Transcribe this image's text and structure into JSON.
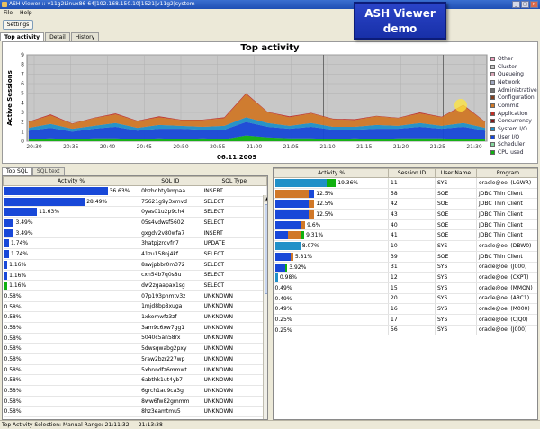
{
  "window": {
    "title": "ASH Viewer :: v11g2Linux86-64|192.168.150.10|1521|v11g2|system"
  },
  "menu": [
    "File",
    "Help"
  ],
  "toolbar": {
    "settings_label": "Settings"
  },
  "tabs": [
    "Top activity",
    "Detail",
    "History"
  ],
  "overlay": {
    "line1": "ASH Viewer",
    "line2": "demo"
  },
  "chart": {
    "title": "Top activity",
    "ylabel": "Active Sessions",
    "date": "06.11.2009",
    "colors": {
      "Other": "#f0a0c0",
      "Cluster": "#c8c8c8",
      "Queueing": "#d8a8b8",
      "Network": "#a0a8c0",
      "Administrative": "#707070",
      "Configuration": "#804020",
      "Commit": "#d07828",
      "Application": "#c03028",
      "Concurrency": "#801818",
      "System I/O": "#2090c8",
      "User I/O": "#1848d8",
      "Scheduler": "#88d8a0",
      "CPU used": "#10b010"
    }
  },
  "chart_data": {
    "type": "area",
    "title": "Top activity",
    "xlabel": "",
    "ylabel": "Active Sessions",
    "ylim": [
      0,
      9
    ],
    "x_ticks": [
      "20:30",
      "20:35",
      "20:40",
      "20:45",
      "20:50",
      "20:55",
      "21:00",
      "21:05",
      "21:10",
      "21:15",
      "21:20",
      "21:25",
      "21:30"
    ],
    "y_ticks": [
      "0",
      "1",
      "2",
      "3",
      "4",
      "5",
      "6",
      "7",
      "8",
      "9"
    ],
    "legend": [
      "Other",
      "Cluster",
      "Queueing",
      "Network",
      "Administrative",
      "Configuration",
      "Commit",
      "Application",
      "Concurrency",
      "System I/O",
      "User I/O",
      "Scheduler",
      "CPU used"
    ],
    "legend_position": "right",
    "grid": true,
    "x": [
      "20:30",
      "20:33",
      "20:36",
      "20:39",
      "20:42",
      "20:45",
      "20:48",
      "20:51",
      "20:54",
      "20:57",
      "21:00",
      "21:03",
      "21:06",
      "21:09",
      "21:12",
      "21:15",
      "21:18",
      "21:21",
      "21:24",
      "21:27",
      "21:30",
      "21:33"
    ],
    "series": [
      {
        "name": "CPU used",
        "values": [
          0.2,
          0.3,
          0.2,
          0.3,
          0.3,
          0.2,
          0.3,
          0.2,
          0.3,
          0.2,
          0.6,
          0.4,
          0.3,
          0.3,
          0.2,
          0.3,
          0.2,
          0.3,
          0.3,
          0.3,
          0.2,
          0.2
        ]
      },
      {
        "name": "User I/O",
        "values": [
          0.9,
          1.1,
          0.8,
          1.0,
          1.2,
          0.9,
          1.0,
          1.1,
          0.9,
          1.0,
          1.4,
          1.1,
          1.0,
          1.2,
          1.0,
          0.9,
          1.1,
          1.0,
          1.2,
          1.0,
          1.3,
          0.9
        ]
      },
      {
        "name": "System I/O",
        "values": [
          0.3,
          0.4,
          0.3,
          0.3,
          0.4,
          0.3,
          0.4,
          0.3,
          0.3,
          0.4,
          0.5,
          0.4,
          0.3,
          0.4,
          0.3,
          0.3,
          0.4,
          0.3,
          0.4,
          0.3,
          0.4,
          0.3
        ]
      },
      {
        "name": "Commit",
        "values": [
          0.6,
          0.9,
          0.5,
          0.8,
          0.9,
          0.7,
          0.8,
          0.6,
          0.7,
          0.8,
          2.4,
          1.1,
          0.9,
          1.0,
          0.8,
          0.7,
          0.9,
          0.8,
          1.0,
          0.9,
          1.8,
          0.6
        ]
      },
      {
        "name": "Application",
        "values": [
          0.05,
          0.1,
          0.05,
          0.05,
          0.1,
          0.05,
          0.1,
          0.05,
          0.05,
          0.1,
          0.1,
          0.05,
          0.1,
          0.05,
          0.05,
          0.1,
          0.05,
          0.05,
          0.1,
          0.05,
          0.1,
          0.05
        ]
      }
    ]
  },
  "selection": {
    "start": "21:11:32",
    "end": "21:13:38"
  },
  "subtabs": [
    "Top SQL",
    "SQL text"
  ],
  "sql_table": {
    "headers": [
      "Activity %",
      "SQL ID",
      "SQL Type"
    ],
    "rows": [
      {
        "pct": "36.63%",
        "value": 36.63,
        "sql_id": "0bzhqhty9mpaa",
        "type": "INSERT",
        "seg": [
          "#1848d8"
        ]
      },
      {
        "pct": "28.49%",
        "value": 28.49,
        "sql_id": "75621g9y3xmvd",
        "type": "SELECT",
        "seg": [
          "#1848d8"
        ]
      },
      {
        "pct": "11.63%",
        "value": 11.63,
        "sql_id": "0yas01u2p9ch4",
        "type": "SELECT",
        "seg": [
          "#1848d8"
        ]
      },
      {
        "pct": "3.49%",
        "value": 3.49,
        "sql_id": "05s4vdwsf5602",
        "type": "SELECT",
        "seg": [
          "#1848d8"
        ]
      },
      {
        "pct": "3.49%",
        "value": 3.49,
        "sql_id": "gxgdv2v80wfa7",
        "type": "INSERT",
        "seg": [
          "#1848d8"
        ]
      },
      {
        "pct": "1.74%",
        "value": 1.74,
        "sql_id": "3hatpjzrqvfn7",
        "type": "UPDATE",
        "seg": [
          "#1848d8"
        ]
      },
      {
        "pct": "1.74%",
        "value": 1.74,
        "sql_id": "41zu158nj4kf",
        "type": "SELECT",
        "seg": [
          "#1848d8"
        ]
      },
      {
        "pct": "1.16%",
        "value": 1.16,
        "sql_id": "8swjpbbr0m372",
        "type": "SELECT",
        "seg": [
          "#1848d8"
        ]
      },
      {
        "pct": "1.16%",
        "value": 1.16,
        "sql_id": "cxn54b7q0s8u",
        "type": "SELECT",
        "seg": [
          "#1848d8"
        ]
      },
      {
        "pct": "1.16%",
        "value": 1.16,
        "sql_id": "dw2zgaapax1sg",
        "type": "SELECT",
        "seg": [
          "#10b010"
        ]
      },
      {
        "pct": "0.58%",
        "value": 0.58,
        "sql_id": "07p193phmtv3z",
        "type": "UNKNOWN",
        "seg": []
      },
      {
        "pct": "0.58%",
        "value": 0.58,
        "sql_id": "1mjd8bp8xuga",
        "type": "UNKNOWN",
        "seg": []
      },
      {
        "pct": "0.58%",
        "value": 0.58,
        "sql_id": "1xkomwfz3zf",
        "type": "UNKNOWN",
        "seg": []
      },
      {
        "pct": "0.58%",
        "value": 0.58,
        "sql_id": "3am9c6xw7gg1",
        "type": "UNKNOWN",
        "seg": []
      },
      {
        "pct": "0.58%",
        "value": 0.58,
        "sql_id": "5040c5an58rx",
        "type": "UNKNOWN",
        "seg": []
      },
      {
        "pct": "0.58%",
        "value": 0.58,
        "sql_id": "5dwsqwabg2pxy",
        "type": "UNKNOWN",
        "seg": []
      },
      {
        "pct": "0.58%",
        "value": 0.58,
        "sql_id": "5raw2bzr227wp",
        "type": "UNKNOWN",
        "seg": []
      },
      {
        "pct": "0.58%",
        "value": 0.58,
        "sql_id": "5xhnndfz6mmwt",
        "type": "UNKNOWN",
        "seg": []
      },
      {
        "pct": "0.58%",
        "value": 0.58,
        "sql_id": "6abthk1ut4yb7",
        "type": "UNKNOWN",
        "seg": []
      },
      {
        "pct": "0.58%",
        "value": 0.58,
        "sql_id": "6grch1au9ca3g",
        "type": "UNKNOWN",
        "seg": []
      },
      {
        "pct": "0.58%",
        "value": 0.58,
        "sql_id": "8ww6fw82gmmm",
        "type": "UNKNOWN",
        "seg": []
      },
      {
        "pct": "0.58%",
        "value": 0.58,
        "sql_id": "8hz3eamtmu5",
        "type": "UNKNOWN",
        "seg": []
      }
    ]
  },
  "session_table": {
    "headers": [
      "Activity %",
      "Session ID",
      "User Name",
      "Program"
    ],
    "rows": [
      {
        "pct": "19.36%",
        "value": 19.36,
        "sid": "11",
        "user": "SYS",
        "program": "oracle@oel (LGWR)",
        "seg": [
          "#2090c8",
          "#10b010"
        ]
      },
      {
        "pct": "12.5%",
        "value": 12.5,
        "sid": "58",
        "user": "SOE",
        "program": "JDBC Thin Client",
        "seg": [
          "#d07828",
          "#1848d8"
        ]
      },
      {
        "pct": "12.5%",
        "value": 12.5,
        "sid": "42",
        "user": "SOE",
        "program": "JDBC Thin Client",
        "seg": [
          "#1848d8",
          "#d07828"
        ]
      },
      {
        "pct": "12.5%",
        "value": 12.5,
        "sid": "43",
        "user": "SOE",
        "program": "JDBC Thin Client",
        "seg": [
          "#1848d8",
          "#d07828"
        ]
      },
      {
        "pct": "9.6%",
        "value": 9.6,
        "sid": "40",
        "user": "SOE",
        "program": "JDBC Thin Client",
        "seg": [
          "#1848d8",
          "#d07828"
        ]
      },
      {
        "pct": "9.31%",
        "value": 9.31,
        "sid": "41",
        "user": "SOE",
        "program": "JDBC Thin Client",
        "seg": [
          "#1848d8",
          "#d07828",
          "#10b010"
        ]
      },
      {
        "pct": "8.07%",
        "value": 8.07,
        "sid": "10",
        "user": "SYS",
        "program": "oracle@oel (DBW0)",
        "seg": [
          "#2090c8"
        ]
      },
      {
        "pct": "5.81%",
        "value": 5.81,
        "sid": "39",
        "user": "SOE",
        "program": "JDBC Thin Client",
        "seg": [
          "#1848d8",
          "#d07828"
        ]
      },
      {
        "pct": "3.92%",
        "value": 3.92,
        "sid": "31",
        "user": "SYS",
        "program": "oracle@oel (J000)",
        "seg": [
          "#1848d8",
          "#10b010"
        ]
      },
      {
        "pct": "0.98%",
        "value": 0.98,
        "sid": "12",
        "user": "SYS",
        "program": "oracle@oel (CKPT)",
        "seg": [
          "#2090c8"
        ]
      },
      {
        "pct": "0.49%",
        "value": 0.49,
        "sid": "15",
        "user": "SYS",
        "program": "oracle@oel (MMON)",
        "seg": []
      },
      {
        "pct": "0.49%",
        "value": 0.49,
        "sid": "20",
        "user": "SYS",
        "program": "oracle@oel (ARC1)",
        "seg": []
      },
      {
        "pct": "0.49%",
        "value": 0.49,
        "sid": "16",
        "user": "SYS",
        "program": "oracle@oel (M000)",
        "seg": []
      },
      {
        "pct": "0.25%",
        "value": 0.25,
        "sid": "17",
        "user": "SYS",
        "program": "oracle@oel (CJQ0)",
        "seg": []
      },
      {
        "pct": "0.25%",
        "value": 0.25,
        "sid": "56",
        "user": "SYS",
        "program": "oracle@oel (J000)",
        "seg": []
      }
    ]
  },
  "status": {
    "text": "Top Activity  Selection: Manual  Range: 21:11:32 --- 21:13:38"
  }
}
